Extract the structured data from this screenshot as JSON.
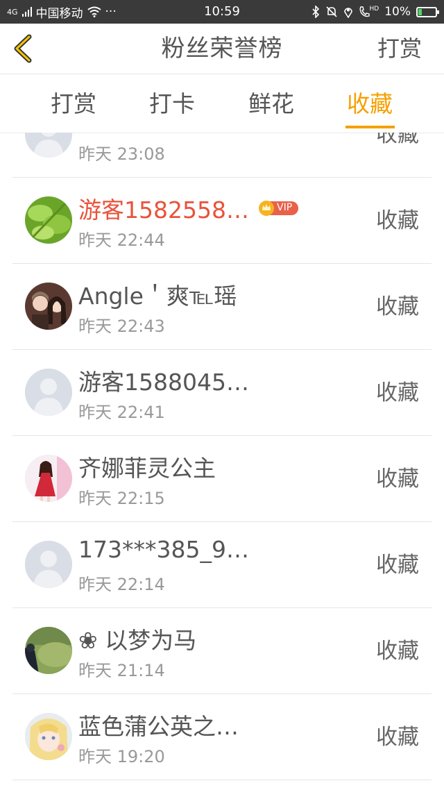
{
  "status_bar": {
    "network": "4G",
    "carrier": "中国移动",
    "more": "···",
    "time": "10:59",
    "hd": "HD",
    "battery": "10%"
  },
  "nav": {
    "title": "粉丝荣誉榜",
    "action": "打赏"
  },
  "tabs": [
    {
      "label": "打赏",
      "active": false
    },
    {
      "label": "打卡",
      "active": false
    },
    {
      "label": "鲜花",
      "active": false
    },
    {
      "label": "收藏",
      "active": true
    }
  ],
  "rows": [
    {
      "name": "",
      "time": "昨天 23:08",
      "action": "收藏",
      "avatar": "default"
    },
    {
      "name": "游客1582558…",
      "time": "昨天 22:44",
      "action": "收藏",
      "avatar": "greens",
      "vip": "VIP"
    },
    {
      "name": "Angle＇爽℡瑶",
      "time": "昨天 22:43",
      "action": "收藏",
      "avatar": "photo-two-girls"
    },
    {
      "name": "游客1588045…",
      "time": "昨天 22:41",
      "action": "收藏",
      "avatar": "default"
    },
    {
      "name": "齐娜菲灵公主",
      "time": "昨天 22:15",
      "action": "收藏",
      "avatar": "red-dress"
    },
    {
      "name": "173***385_9…",
      "time": "昨天 22:14",
      "action": "收藏",
      "avatar": "default"
    },
    {
      "name": "❀ 以梦为马",
      "time": "昨天 21:14",
      "action": "收藏",
      "avatar": "green-scene"
    },
    {
      "name": "蓝色蒲公英之…",
      "time": "昨天 19:20",
      "action": "收藏",
      "avatar": "anime"
    }
  ]
}
